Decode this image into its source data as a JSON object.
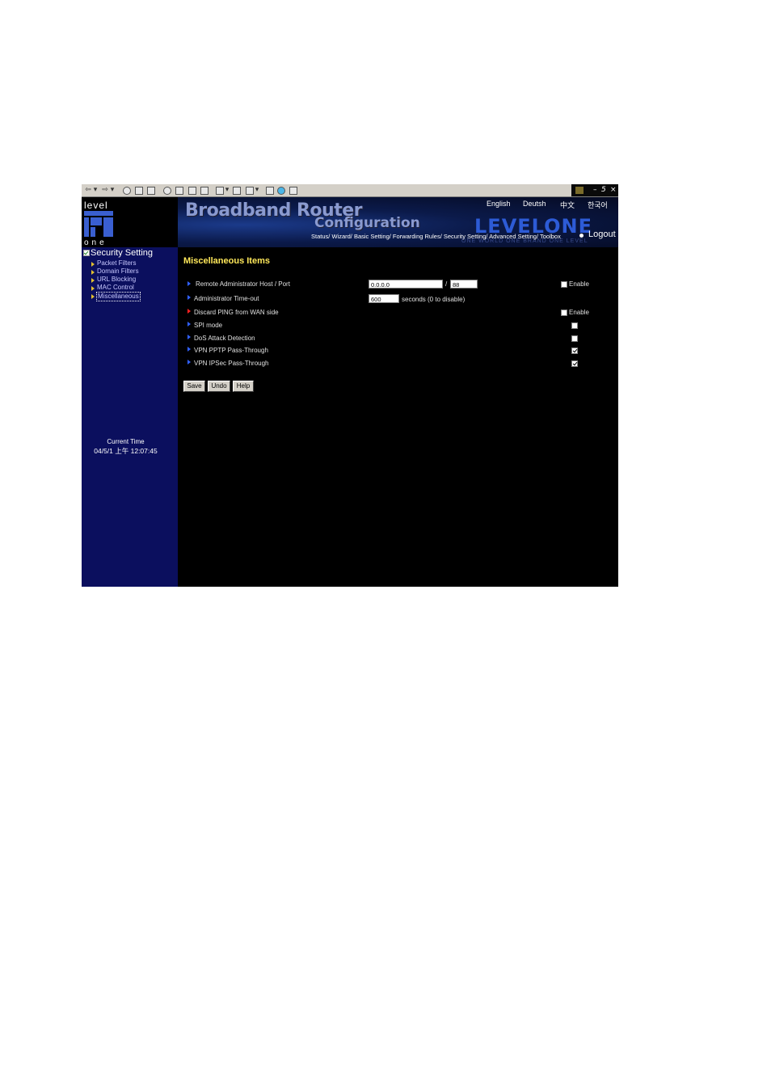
{
  "header": {
    "logo_top": "level",
    "logo_bottom": "one",
    "title_line1": "Broadband Router",
    "title_line2": "Configuration",
    "brand": "LEVELONE",
    "slogan": "ONE WORLD ONE BRAND ONE LEVEL",
    "languages": [
      "English",
      "Deutsh",
      "中文",
      "한국어"
    ],
    "nav": [
      "Status/",
      "Wizard/",
      "Basic Setting/",
      "Forwarding Rules/",
      "Security Setting/",
      "Advanced Setting/",
      "Toolbox"
    ],
    "logout": "Logout"
  },
  "sidebar": {
    "section_title": "Security Setting",
    "items": [
      "Packet Filters",
      "Domain Filters",
      "URL Blocking",
      "MAC Control",
      "Miscellaneous"
    ],
    "active_index": 4,
    "time_label": "Current Time",
    "time_value": "04/5/1 上午 12:07:45"
  },
  "main": {
    "title": "Miscellaneous Items",
    "remote_admin": {
      "label": "Remote Administrator Host / Port",
      "host": "0.0.0.0",
      "separator": "/",
      "port": "88",
      "enable_label": "Enable",
      "enabled": false
    },
    "timeout": {
      "label": "Administrator Time-out",
      "value": "600",
      "suffix": "seconds (0 to disable)"
    },
    "discard_ping": {
      "label": "Discard PING from WAN side",
      "enable_label": "Enable",
      "enabled": false
    },
    "spi_mode": {
      "label": "SPI mode",
      "checked": false
    },
    "dos": {
      "label": "DoS Attack Detection",
      "checked": false
    },
    "pptp": {
      "label": "VPN PPTP Pass-Through",
      "checked": true
    },
    "ipsec": {
      "label": "VPN IPSec Pass-Through",
      "checked": true
    },
    "buttons": {
      "save": "Save",
      "undo": "Undo",
      "help": "Help"
    }
  },
  "window": {
    "minimize": "–",
    "restore": "5",
    "close": "×"
  }
}
